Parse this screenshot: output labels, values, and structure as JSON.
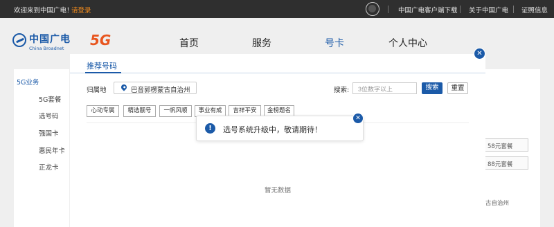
{
  "topbar": {
    "welcome": "欢迎来到中国广电！",
    "login": "请登录",
    "app_icon": "client-app-icon",
    "links": [
      "中国广电客户端下载",
      "关于中国广电",
      "证照信息"
    ]
  },
  "header": {
    "logo_cn": "中国广电",
    "logo_en": "China Broadnet",
    "logo_5g": "5G",
    "nav": [
      "首页",
      "服务",
      "号卡",
      "个人中心"
    ],
    "active_nav": "号卡"
  },
  "sidebar": {
    "heading": "5G业务",
    "items": [
      "5G套餐",
      "选号码",
      "强国卡",
      "惠民年卡",
      "正龙卡"
    ]
  },
  "background_right": {
    "packages": [
      "58元套餐",
      "88元套餐"
    ],
    "region": "古自治州"
  },
  "modal": {
    "title": "推荐号码",
    "region_label": "归属地",
    "region_value": "巴音郭楞蒙古自治州",
    "search_label": "搜索:",
    "search_placeholder": "3位数字以上",
    "search_button": "搜索",
    "reset_button": "重置",
    "tags": [
      "心动专属",
      "精选靓号",
      "一帆风顺",
      "事业有成",
      "吉祥平安",
      "金榜题名"
    ],
    "empty_text": "暂无数据",
    "close_symbol": "✕"
  },
  "toast": {
    "icon": "!",
    "message": "选号系统升级中，敬请期待！",
    "close_symbol": "✕"
  },
  "colors": {
    "accent": "#1b5aa8",
    "login": "#f08a1c",
    "logo_5g": "#e8551e",
    "topbar": "#2f2f2f"
  }
}
